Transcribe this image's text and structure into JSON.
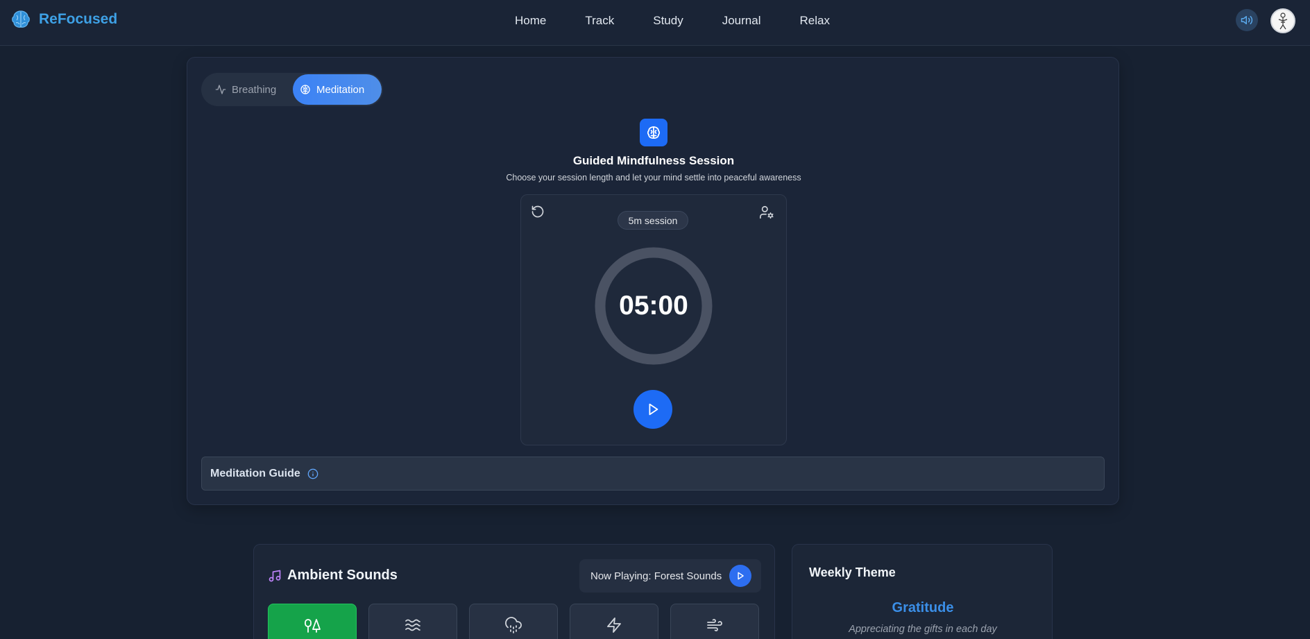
{
  "header": {
    "logo_text": "ReFocused",
    "nav": [
      "Home",
      "Track",
      "Study",
      "Journal",
      "Relax"
    ]
  },
  "tabs": {
    "breathing": "Breathing",
    "meditation": "Meditation",
    "active": "meditation"
  },
  "session": {
    "title": "Guided Mindfulness Session",
    "subtitle": "Choose your session length and let your mind settle into peaceful awareness",
    "badge": "5m session",
    "timer": "05:00",
    "progress": 0
  },
  "guide": {
    "label": "Meditation Guide"
  },
  "ambient": {
    "title": "Ambient Sounds",
    "now_playing": "Now Playing: Forest Sounds",
    "tiles": [
      {
        "icon": "trees-icon",
        "active": true
      },
      {
        "icon": "waves-icon",
        "active": false
      },
      {
        "icon": "cloud-rain-icon",
        "active": false
      },
      {
        "icon": "zap-icon",
        "active": false
      },
      {
        "icon": "wind-icon",
        "active": false
      }
    ]
  },
  "weekly": {
    "title": "Weekly Theme",
    "theme": "Gratitude",
    "description": "Appreciating the gifts in each day"
  },
  "colors": {
    "accent": "#1d6bf5",
    "brand": "#3ea1e6",
    "active_sound": "#15a34a",
    "background": "#172131"
  }
}
